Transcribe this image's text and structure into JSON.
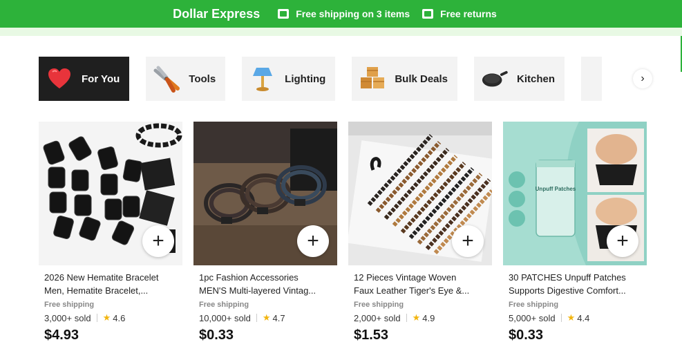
{
  "header": {
    "brand": "Dollar Express",
    "promo1": "Free shipping on 3 items",
    "promo2": "Free returns"
  },
  "categories": [
    {
      "label": "For You",
      "icon": "heart-icon"
    },
    {
      "label": "Tools",
      "icon": "pliers-icon"
    },
    {
      "label": "Lighting",
      "icon": "lamp-icon"
    },
    {
      "label": "Bulk Deals",
      "icon": "boxes-icon"
    },
    {
      "label": "Kitchen",
      "icon": "pan-icon"
    }
  ],
  "products": [
    {
      "title1": "2026 New Hematite Bracelet",
      "title2": "Men, Hematite Bracelet,...",
      "shipping": "Free shipping",
      "sold": "3,000+ sold",
      "rating": "4.6",
      "price": "$4.93"
    },
    {
      "title1": "1pc Fashion Accessories",
      "title2": "MEN'S Multi-layered Vintag...",
      "shipping": "Free shipping",
      "sold": "10,000+ sold",
      "rating": "4.7",
      "price": "$0.33"
    },
    {
      "title1": "12 Pieces Vintage Woven",
      "title2": "Faux Leather Tiger's Eye &...",
      "shipping": "Free shipping",
      "sold": "2,000+ sold",
      "rating": "4.9",
      "price": "$1.53"
    },
    {
      "title1": "30 PATCHES Unpuff Patches",
      "title2": "Supports Digestive Comfort...",
      "shipping": "Free shipping",
      "sold": "5,000+ sold",
      "rating": "4.4",
      "price": "$0.33"
    }
  ],
  "packaging": {
    "patch_label": "Unpuff Patches"
  },
  "colors": {
    "brand_green": "#2db23a",
    "rating_star": "#f2b50f"
  }
}
